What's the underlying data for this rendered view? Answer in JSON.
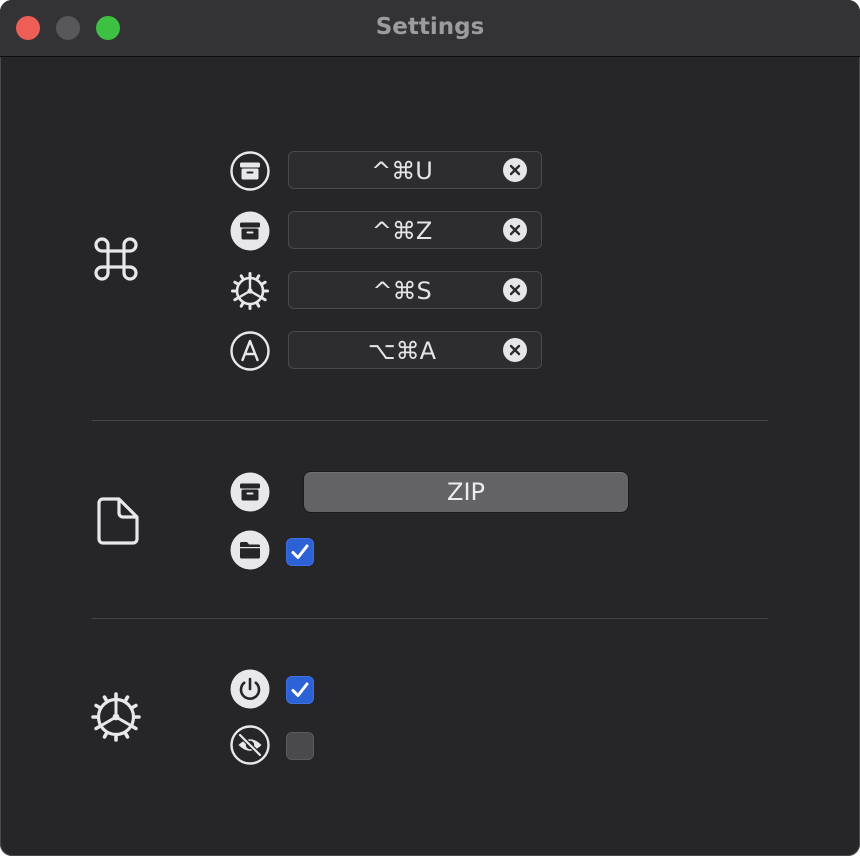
{
  "window": {
    "title": "Settings"
  },
  "sections": {
    "shortcuts": {
      "section_icon": "command-icon",
      "rows": [
        {
          "icon": "archive-circle-icon",
          "keys": "^⌘U"
        },
        {
          "icon": "archive-filled-circle-icon",
          "keys": "^⌘Z"
        },
        {
          "icon": "gear-icon",
          "keys": "^⌘S"
        },
        {
          "icon": "letter-a-circle-icon",
          "keys": "⌥⌘A"
        }
      ]
    },
    "file": {
      "section_icon": "document-icon",
      "format_icon": "archive-filled-circle-icon",
      "format_value": "ZIP",
      "folder_icon": "folder-filled-circle-icon",
      "folder_checked": true
    },
    "general": {
      "section_icon": "gear-icon",
      "power_icon": "power-filled-circle-icon",
      "power_checked": true,
      "hidden_icon": "eye-slash-circle-icon",
      "hidden_checked": false
    }
  },
  "colors": {
    "accent": "#2c62d6",
    "close": "#ee5f57",
    "minimize": "#58585a",
    "zoom": "#3ec143"
  }
}
